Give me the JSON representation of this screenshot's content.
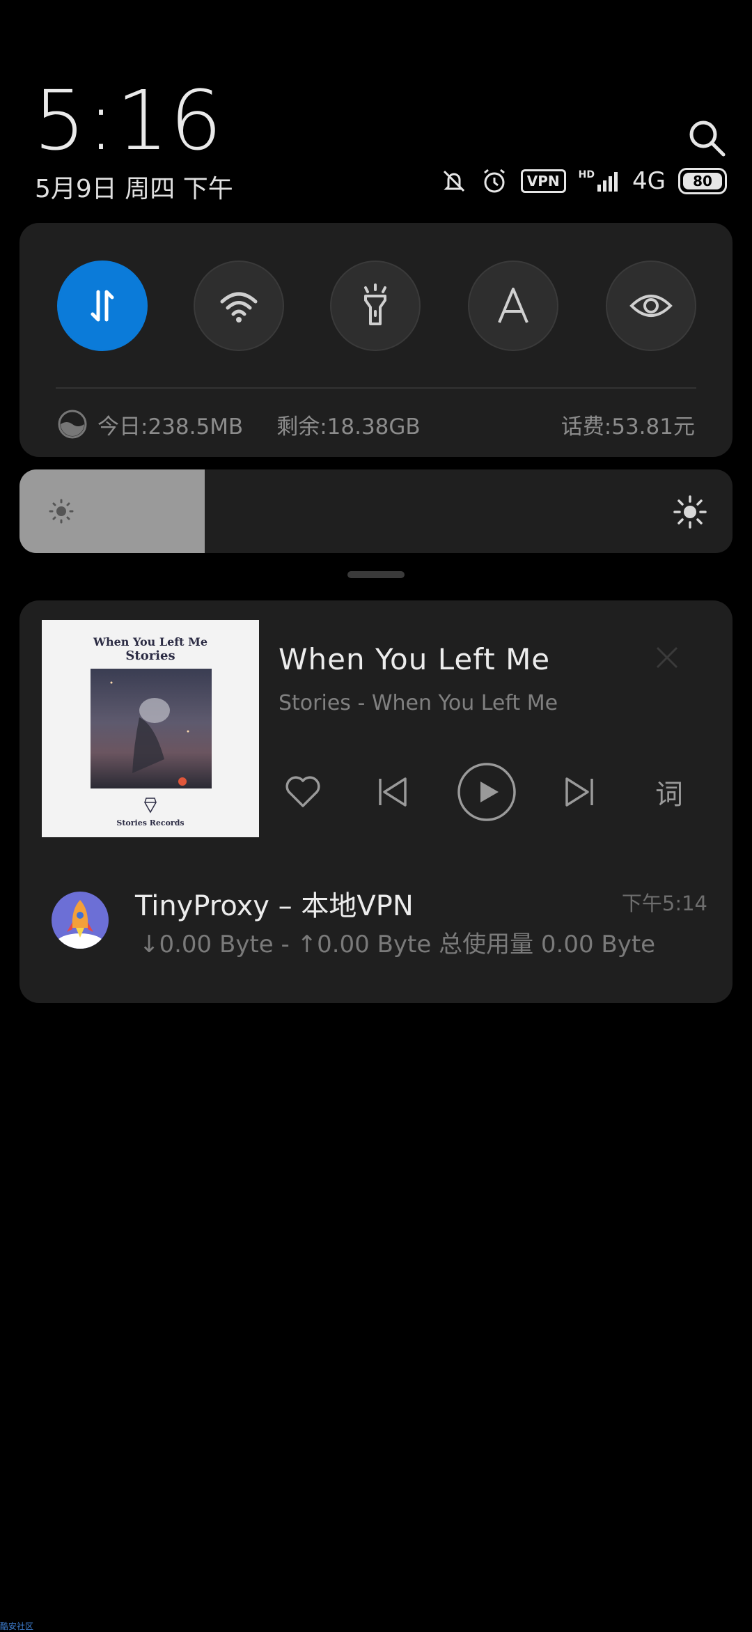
{
  "status": {
    "time": "5:16",
    "date": "5月9日 周四 下午",
    "vpn_label": "VPN",
    "hd_label": "HD",
    "network": "4G",
    "battery": "80"
  },
  "quick_settings": {
    "toggles": [
      {
        "name": "mobile-data",
        "icon": "data-transfer-icon",
        "active": true
      },
      {
        "name": "wifi",
        "icon": "wifi-icon",
        "active": false
      },
      {
        "name": "flashlight",
        "icon": "flashlight-icon",
        "active": false
      },
      {
        "name": "auto-brightness",
        "icon": "auto-brightness-icon",
        "active": false
      },
      {
        "name": "reading-mode",
        "icon": "eye-icon",
        "active": false
      }
    ],
    "data_today": "今日:238.5MB",
    "data_remaining": "剩余:18.38GB",
    "balance": "话费:53.81元"
  },
  "brightness": {
    "level": 0.26
  },
  "music": {
    "album_title_line1": "When You Left Me",
    "album_title_line2": "Stories",
    "album_label": "Stories Records",
    "title": "When You Left Me",
    "subtitle": "Stories - When You Left Me",
    "lyrics_label": "词"
  },
  "vpn_notification": {
    "title": "TinyProxy – 本地VPN",
    "time": "下午5:14",
    "stats": "↓0.00 Byte - ↑0.00 Byte 总使用量 0.00 Byte"
  },
  "watermark": "酷安社区",
  "colors": {
    "accent": "#0b7bd9",
    "panel": "#1f1f1f",
    "background": "#000000"
  }
}
